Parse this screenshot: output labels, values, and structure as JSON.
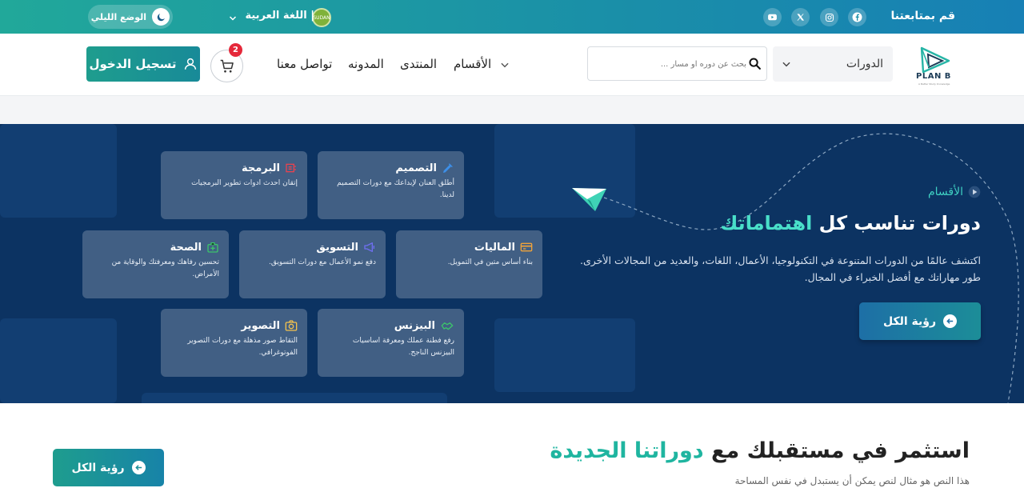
{
  "topbar": {
    "follow_label": "قم بمتابعتنا",
    "social": [
      "facebook-icon",
      "instagram-icon",
      "x-icon",
      "youtube-icon"
    ],
    "language_label": "اللغة العربية",
    "language_separator": "|",
    "flag_text": "SUDAN",
    "night_mode_label": "الوضع الليلي"
  },
  "header": {
    "logo_text": "PLAN B",
    "logo_tagline": "A Better Study Knowledge",
    "courses_dropdown_label": "الدورات",
    "search_placeholder": "بحث عن دوره او مسار ...",
    "nav": [
      "الأقسام",
      "المنتدى",
      "المدونه",
      "تواصل معنا"
    ],
    "cart_count": "2",
    "login_label": "تسجيل الدخول"
  },
  "hero": {
    "breadcrumb": "الأقسام",
    "title_plain": "دورات تناسب كل ",
    "title_accent": "اهتماماتك",
    "description": "اكتشف عالمًا من الدورات المتنوعة في التكنولوجيا، الأعمال، اللغات، والعديد من المجالات الأخرى. طور مهاراتك مع أفضل الخبراء في المجال.",
    "view_all_label": "رؤية الكل",
    "cards": [
      {
        "title": "التصميم",
        "desc": "أطلق العنان لإبداعك مع دورات التصميم لدينا.",
        "icon": "design-icon",
        "color": "#3d8fe8"
      },
      {
        "title": "البرمجة",
        "desc": "إتقان احدث ادوات تطوير البرمجيات",
        "icon": "code-icon",
        "color": "#e8424f"
      },
      {
        "title": "الماليات",
        "desc": "بناء أساس متين في التمويل.",
        "icon": "finance-icon",
        "color": "#f0a33a"
      },
      {
        "title": "التسويق",
        "desc": "دفع نمو الأعمال مع دورات التسويق.",
        "icon": "marketing-icon",
        "color": "#6f6ff0"
      },
      {
        "title": "الصحة",
        "desc": "تحسين رفاهك ومعرفتك والوقاية من الأمراض.",
        "icon": "health-icon",
        "color": "#3cc36b"
      },
      {
        "title": "البيزنس",
        "desc": "رفع فطنة عملك ومعرفة اساسيات البيزنس الناجح.",
        "icon": "business-icon",
        "color": "#3cc36b"
      },
      {
        "title": "التصوير",
        "desc": "التقاط صور مذهلة مع دورات التصوير الفوتوغرافي.",
        "icon": "camera-icon",
        "color": "#f2c14e"
      }
    ]
  },
  "section": {
    "title_plain": "استثمر في مستقبلك مع ",
    "title_accent": "دوراتنا الجديدة",
    "subtitle": "هذا النص هو مثال لنص يمكن أن يستبدل في نفس المساحة",
    "view_all_label": "رؤية الكل"
  }
}
